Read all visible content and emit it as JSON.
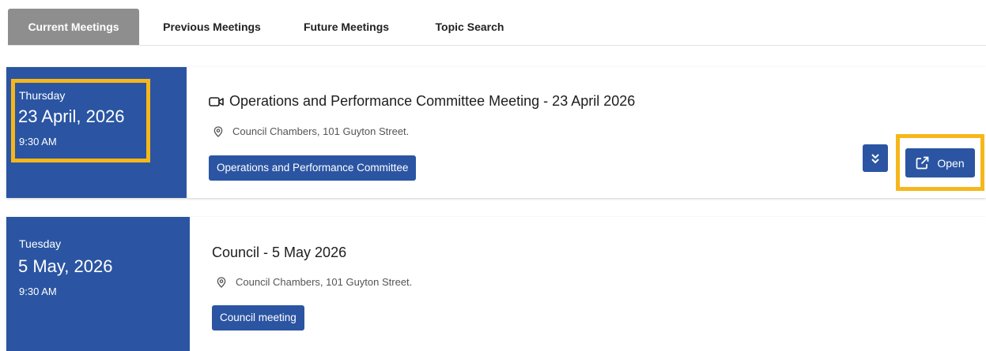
{
  "tabs": [
    {
      "label": "Current Meetings",
      "active": true
    },
    {
      "label": "Previous Meetings",
      "active": false
    },
    {
      "label": "Future Meetings",
      "active": false
    },
    {
      "label": "Topic Search",
      "active": false
    }
  ],
  "meetings": [
    {
      "day": "Thursday",
      "date": "23 April, 2026",
      "time": "9:30 AM",
      "title": "Operations and Performance Committee Meeting - 23 April 2026",
      "location": "Council Chambers, 101 Guyton Street.",
      "tag": "Operations and Performance Committee",
      "icon": "video-icon"
    },
    {
      "day": "Tuesday",
      "date": "5 May, 2026",
      "time": "9:30 AM",
      "title": "Council - 5 May 2026",
      "location": "Council Chambers, 101 Guyton Street.",
      "tag": "Council meeting"
    }
  ],
  "actions": {
    "open_label": "Open"
  },
  "colors": {
    "primary": "#2b55a2",
    "active_tab": "#8e8e8e",
    "highlight": "#f6b71a"
  }
}
